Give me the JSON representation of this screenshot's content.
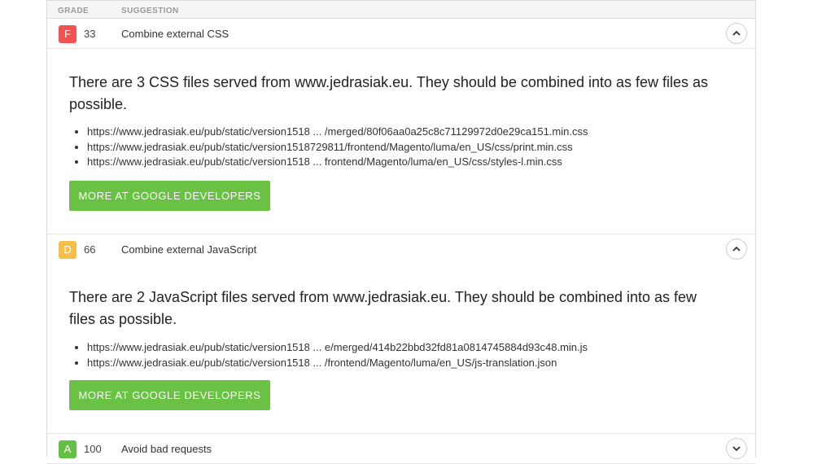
{
  "table": {
    "grade_header": "GRADE",
    "suggestion_header": "SUGGESTION"
  },
  "rows": [
    {
      "grade": "F",
      "grade_color": "#f05352",
      "score": "33",
      "suggestion": "Combine external CSS",
      "expanded": true,
      "message": "There are 3 CSS files served from www.jedrasiak.eu. They should be combined into as few files as possible.",
      "files": [
        "https://www.jedrasiak.eu/pub/static/version1518 ... /merged/80f06aa0a25c8c71129972d0e29ca151.min.css",
        "https://www.jedrasiak.eu/pub/static/version1518729811/frontend/Magento/luma/en_US/css/print.min.css",
        "https://www.jedrasiak.eu/pub/static/version1518 ... frontend/Magento/luma/en_US/css/styles-l.min.css"
      ],
      "button": "MORE AT GOOGLE DEVELOPERS"
    },
    {
      "grade": "D",
      "grade_color": "#f5c04a",
      "score": "66",
      "suggestion": "Combine external JavaScript",
      "expanded": true,
      "message": "There are 2 JavaScript files served from www.jedrasiak.eu. They should be combined into as few files as possible.",
      "files": [
        "https://www.jedrasiak.eu/pub/static/version1518 ... e/merged/414b22bbd32fd81a0814745884d93c48.min.js",
        "https://www.jedrasiak.eu/pub/static/version1518 ... /frontend/Magento/luma/en_US/js-translation.json"
      ],
      "button": "MORE AT GOOGLE DEVELOPERS"
    },
    {
      "grade": "A",
      "grade_color": "#64bf46",
      "score": "100",
      "suggestion": "Avoid bad requests",
      "expanded": false
    }
  ],
  "icons": {
    "expanded": "chevron-up-icon",
    "collapsed": "chevron-down-icon"
  }
}
